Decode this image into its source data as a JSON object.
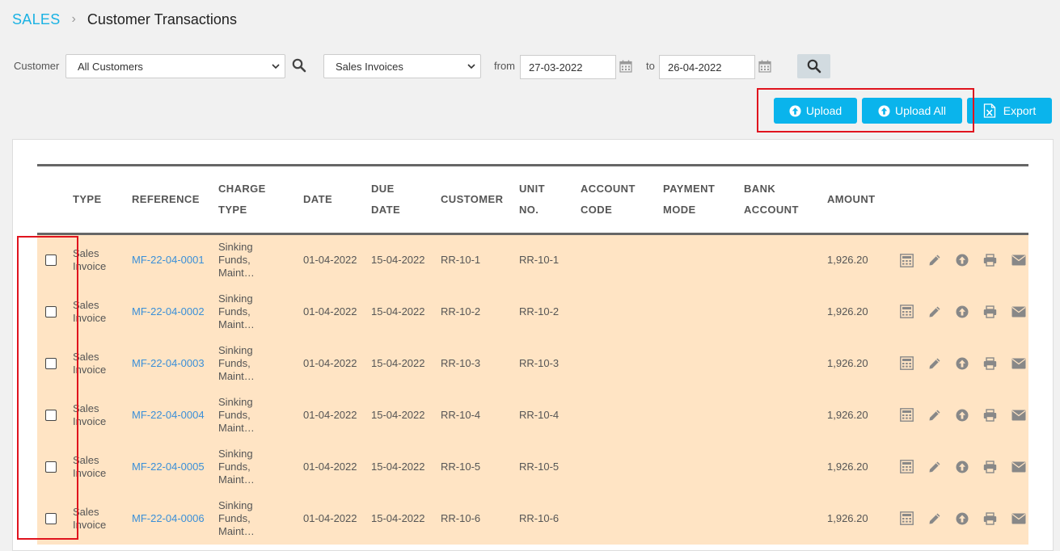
{
  "breadcrumb": {
    "section": "SALES",
    "separator": "›",
    "page": "Customer Transactions"
  },
  "filters": {
    "customer_label": "Customer",
    "customer_value": "All Customers",
    "doc_type_value": "Sales Invoices",
    "from_label": "from",
    "from_date": "27-03-2022",
    "to_label": "to",
    "to_date": "26-04-2022"
  },
  "actions": {
    "upload": "Upload",
    "upload_all": "Upload All",
    "export": "Export"
  },
  "colors": {
    "accent": "#0ab4ec",
    "row_highlight": "#ffe4c4",
    "link": "#3a8fd8",
    "annotation": "#e0141e"
  },
  "table": {
    "headers": {
      "type": "TYPE",
      "reference": "REFERENCE",
      "charge_type_1": "CHARGE",
      "charge_type_2": "TYPE",
      "date": "DATE",
      "due_1": "DUE",
      "due_2": "DATE",
      "customer": "CUSTOMER",
      "unit_1": "UNIT",
      "unit_2": "NO.",
      "account_1": "ACCOUNT",
      "account_2": "CODE",
      "payment_1": "PAYMENT",
      "payment_2": "MODE",
      "bank_1": "BANK",
      "bank_2": "ACCOUNT",
      "amount": "AMOUNT"
    },
    "row_icons": [
      "calculator-icon",
      "pencil-icon",
      "upload-circle-icon",
      "print-icon",
      "envelope-icon"
    ],
    "rows": [
      {
        "type_1": "Sales",
        "type_2": "Invoice",
        "reference": "MF-22-04-0001",
        "charge_1": "Sinking",
        "charge_2": "Funds,",
        "charge_3": "Maint…",
        "date": "01-04-2022",
        "due_date": "15-04-2022",
        "customer": "RR-10-1",
        "unit": "RR-10-1",
        "account_code": "",
        "payment_mode": "",
        "bank_account": "",
        "amount": "1,926.20"
      },
      {
        "type_1": "Sales",
        "type_2": "Invoice",
        "reference": "MF-22-04-0002",
        "charge_1": "Sinking",
        "charge_2": "Funds,",
        "charge_3": "Maint…",
        "date": "01-04-2022",
        "due_date": "15-04-2022",
        "customer": "RR-10-2",
        "unit": "RR-10-2",
        "account_code": "",
        "payment_mode": "",
        "bank_account": "",
        "amount": "1,926.20"
      },
      {
        "type_1": "Sales",
        "type_2": "Invoice",
        "reference": "MF-22-04-0003",
        "charge_1": "Sinking",
        "charge_2": "Funds,",
        "charge_3": "Maint…",
        "date": "01-04-2022",
        "due_date": "15-04-2022",
        "customer": "RR-10-3",
        "unit": "RR-10-3",
        "account_code": "",
        "payment_mode": "",
        "bank_account": "",
        "amount": "1,926.20"
      },
      {
        "type_1": "Sales",
        "type_2": "Invoice",
        "reference": "MF-22-04-0004",
        "charge_1": "Sinking",
        "charge_2": "Funds,",
        "charge_3": "Maint…",
        "date": "01-04-2022",
        "due_date": "15-04-2022",
        "customer": "RR-10-4",
        "unit": "RR-10-4",
        "account_code": "",
        "payment_mode": "",
        "bank_account": "",
        "amount": "1,926.20"
      },
      {
        "type_1": "Sales",
        "type_2": "Invoice",
        "reference": "MF-22-04-0005",
        "charge_1": "Sinking",
        "charge_2": "Funds,",
        "charge_3": "Maint…",
        "date": "01-04-2022",
        "due_date": "15-04-2022",
        "customer": "RR-10-5",
        "unit": "RR-10-5",
        "account_code": "",
        "payment_mode": "",
        "bank_account": "",
        "amount": "1,926.20"
      },
      {
        "type_1": "Sales",
        "type_2": "Invoice",
        "reference": "MF-22-04-0006",
        "charge_1": "Sinking",
        "charge_2": "Funds,",
        "charge_3": "Maint…",
        "date": "01-04-2022",
        "due_date": "15-04-2022",
        "customer": "RR-10-6",
        "unit": "RR-10-6",
        "account_code": "",
        "payment_mode": "",
        "bank_account": "",
        "amount": "1,926.20"
      }
    ]
  }
}
